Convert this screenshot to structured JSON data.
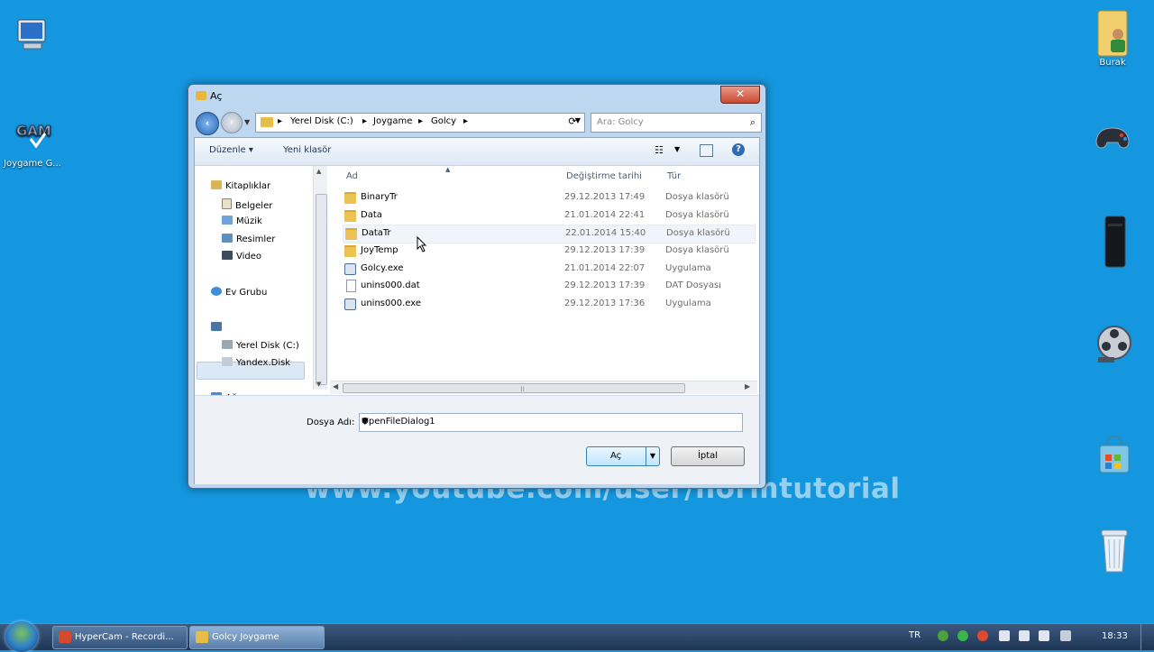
{
  "desktop": {
    "icons": [
      {
        "label": ""
      },
      {
        "label": "Joygame G..."
      },
      {
        "label": "Burak"
      },
      {
        "label": ""
      },
      {
        "label": ""
      },
      {
        "label": ""
      },
      {
        "label": ""
      },
      {
        "label": ""
      }
    ],
    "watermark": "www.youtube.com/user/normtutorial"
  },
  "dialog": {
    "title": "Aç",
    "close": "✕",
    "address": {
      "segments": [
        "Yerel Disk (C:)",
        "Joygame",
        "Golcy"
      ]
    },
    "search_placeholder": "Ara: Golcy",
    "toolbar": {
      "organize": "Düzenle ▾",
      "new_folder": "Yeni klasör"
    },
    "nav_pane": {
      "items": [
        {
          "label": "Kitaplıklar"
        },
        {
          "label": "Belgeler"
        },
        {
          "label": "Müzik"
        },
        {
          "label": "Resimler"
        },
        {
          "label": "Video"
        },
        {
          "label": "Ev Grubu"
        },
        {
          "label": ""
        },
        {
          "label": "Yerel Disk (C:)"
        },
        {
          "label": "Yandex.Disk"
        },
        {
          "label": "Ağ"
        }
      ]
    },
    "columns": {
      "name": "Ad",
      "date": "Değiştirme tarihi",
      "type": "Tür"
    },
    "files": [
      {
        "name": "BinaryTr",
        "date": "29.12.2013 17:49",
        "type": "Dosya klasörü"
      },
      {
        "name": "Data",
        "date": "21.01.2014 22:41",
        "type": "Dosya klasörü"
      },
      {
        "name": "DataTr",
        "date": "22.01.2014 15:40",
        "type": "Dosya klasörü"
      },
      {
        "name": "JoyTemp",
        "date": "29.12.2013 17:39",
        "type": "Dosya klasörü"
      },
      {
        "name": "Golcy.exe",
        "date": "21.01.2014 22:07",
        "type": "Uygulama"
      },
      {
        "name": "unins000.dat",
        "date": "29.12.2013 17:39",
        "type": "DAT Dosyası"
      },
      {
        "name": "unins000.exe",
        "date": "29.12.2013 17:36",
        "type": "Uygulama"
      }
    ],
    "filename_label": "Dosya Adı:",
    "filename_value": "OpenFileDialog1",
    "open_label": "Aç",
    "cancel_label": "İptal"
  },
  "taskbar": {
    "buttons": [
      {
        "label": "HyperCam - Recordi..."
      },
      {
        "label": "Golcy Joygame"
      }
    ],
    "lang": "TR",
    "clock": "18:33"
  }
}
